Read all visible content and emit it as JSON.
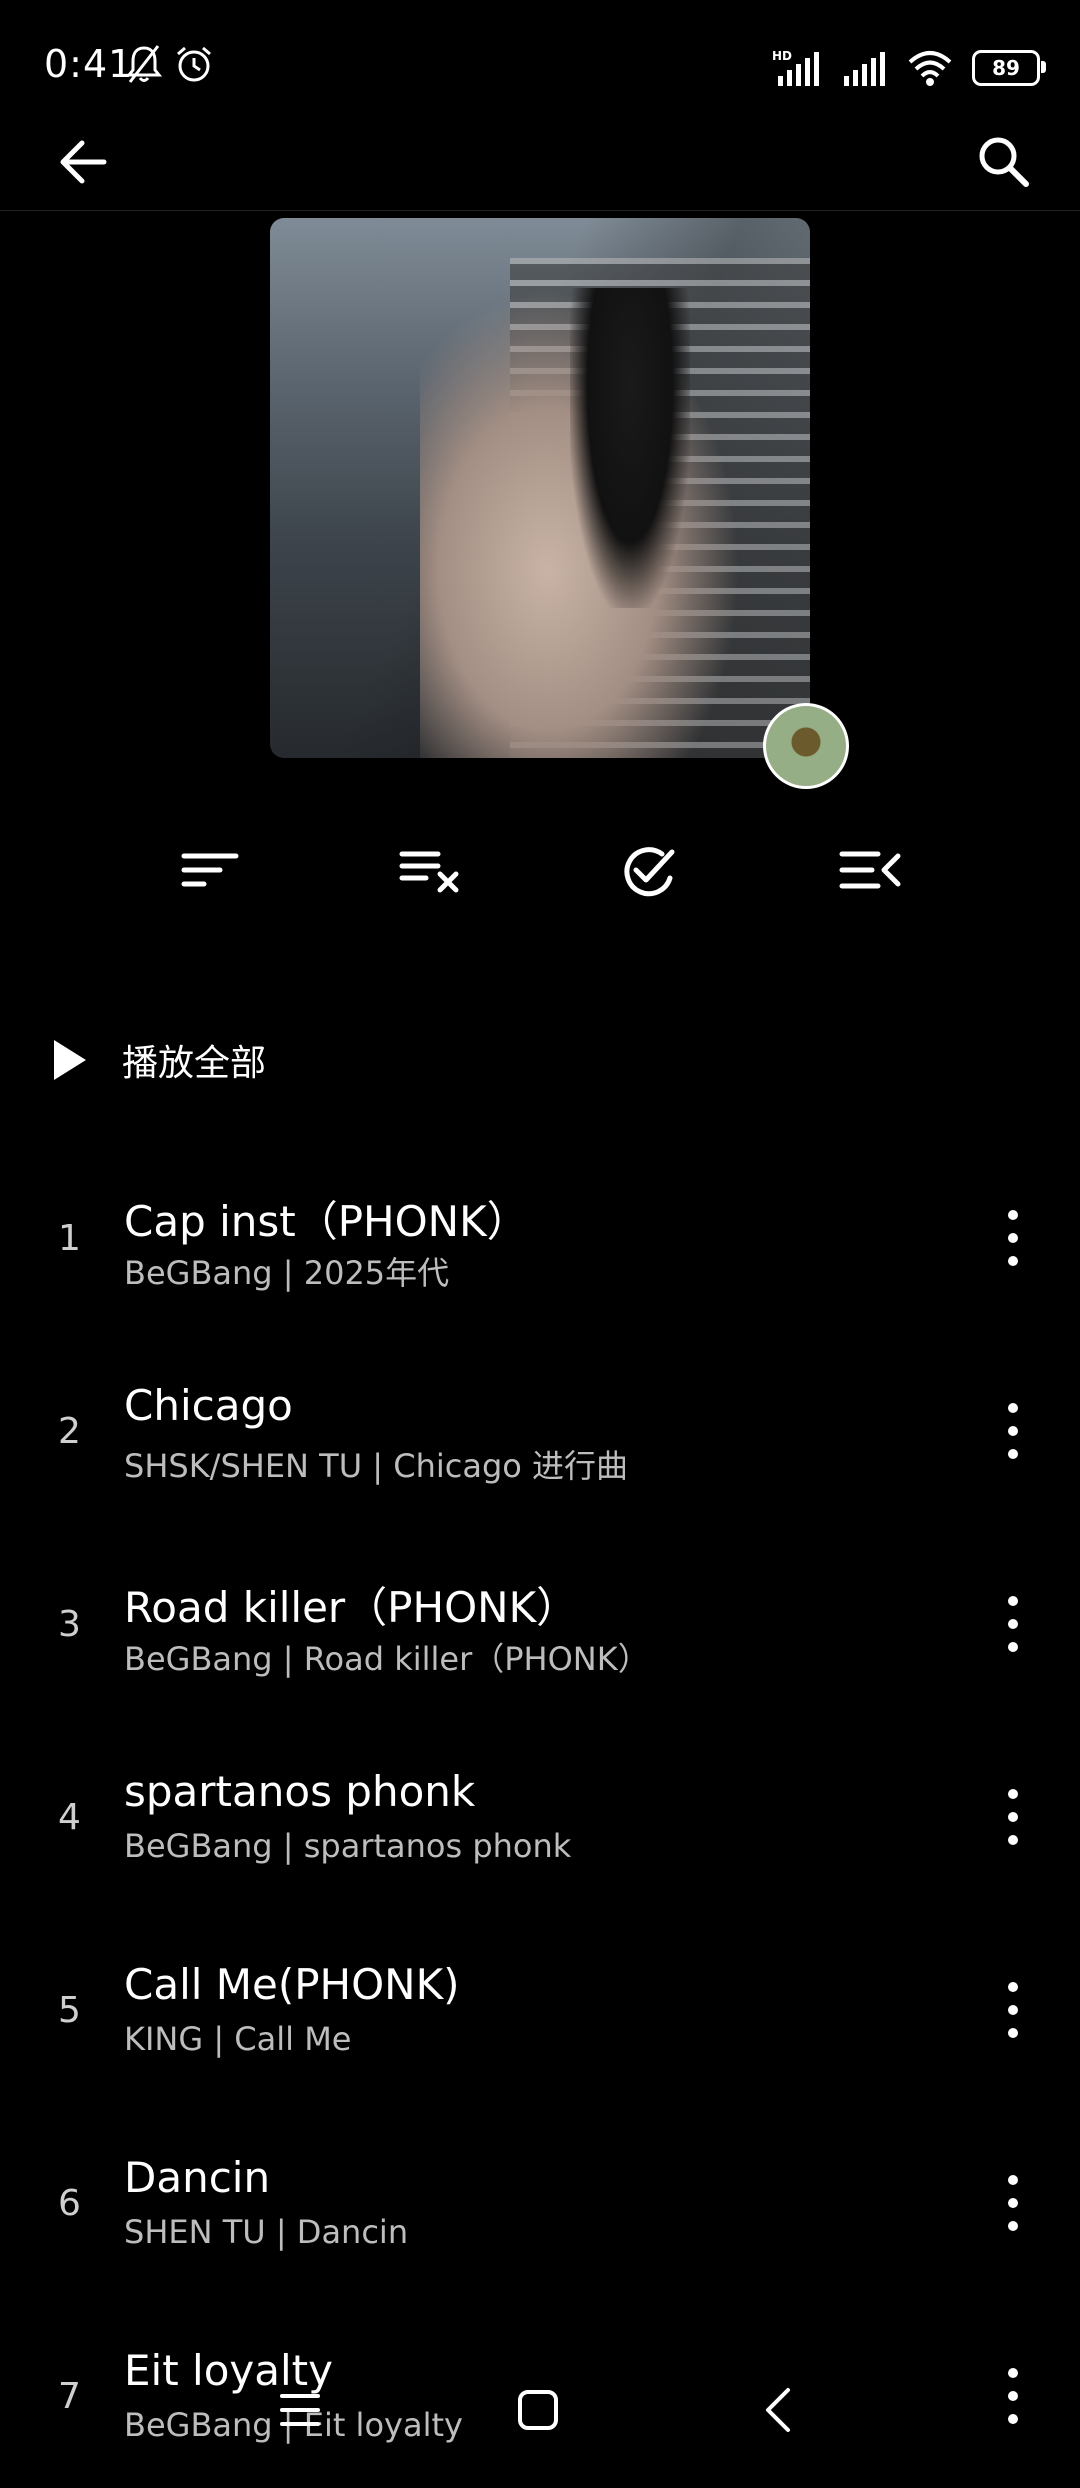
{
  "status_bar": {
    "time": "0:41",
    "battery": "89",
    "icons": [
      "bell-muted-icon",
      "alarm-icon",
      "hd-signal-icon",
      "signal-icon",
      "wifi-icon",
      "battery-icon"
    ]
  },
  "header": {
    "back_icon": "arrow-left-icon",
    "search_icon": "search-icon"
  },
  "toolbar": {
    "buttons": [
      "sort-icon",
      "clear-list-icon",
      "select-icon",
      "queue-icon"
    ]
  },
  "play_all": {
    "label": "播放全部"
  },
  "songs": [
    {
      "num": "1",
      "title": "Cap inst（PHONK）",
      "subtitle": "BeGBang |  2025年代"
    },
    {
      "num": "2",
      "title": "Chicago",
      "subtitle": "SHSK/SHEN TU |  Chicago 进行曲"
    },
    {
      "num": "3",
      "title": "Road killer（PHONK）",
      "subtitle": "BeGBang |  Road killer（PHONK）"
    },
    {
      "num": "4",
      "title": "spartanos phonk",
      "subtitle": "BeGBang |  spartanos phonk"
    },
    {
      "num": "5",
      "title": "Call Me(PHONK)",
      "subtitle": "KING |  Call Me"
    },
    {
      "num": "6",
      "title": "Dancin",
      "subtitle": "SHEN TU |  Dancin"
    },
    {
      "num": "7",
      "title": "Eit loyalty",
      "subtitle": "BeGBang |  Eit loyalty"
    }
  ],
  "nav_bar": {
    "icons": [
      "menu-icon",
      "home-square-icon",
      "back-chevron-icon"
    ]
  }
}
